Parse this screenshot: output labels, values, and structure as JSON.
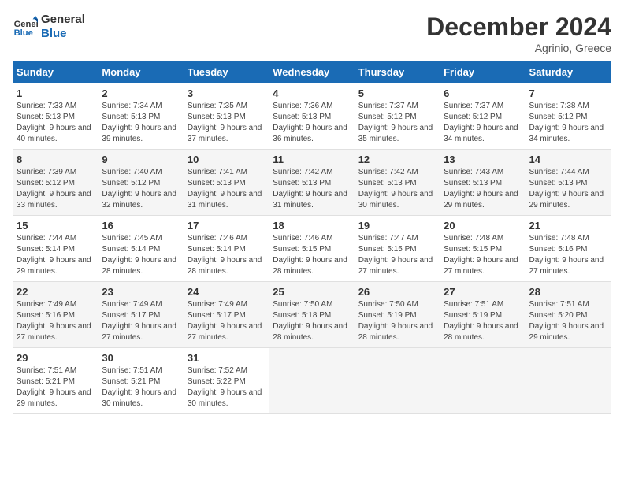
{
  "header": {
    "logo_general": "General",
    "logo_blue": "Blue",
    "month_title": "December 2024",
    "subtitle": "Agrinio, Greece"
  },
  "days_of_week": [
    "Sunday",
    "Monday",
    "Tuesday",
    "Wednesday",
    "Thursday",
    "Friday",
    "Saturday"
  ],
  "weeks": [
    [
      {
        "day": "1",
        "sunrise": "Sunrise: 7:33 AM",
        "sunset": "Sunset: 5:13 PM",
        "daylight": "Daylight: 9 hours and 40 minutes."
      },
      {
        "day": "2",
        "sunrise": "Sunrise: 7:34 AM",
        "sunset": "Sunset: 5:13 PM",
        "daylight": "Daylight: 9 hours and 39 minutes."
      },
      {
        "day": "3",
        "sunrise": "Sunrise: 7:35 AM",
        "sunset": "Sunset: 5:13 PM",
        "daylight": "Daylight: 9 hours and 37 minutes."
      },
      {
        "day": "4",
        "sunrise": "Sunrise: 7:36 AM",
        "sunset": "Sunset: 5:13 PM",
        "daylight": "Daylight: 9 hours and 36 minutes."
      },
      {
        "day": "5",
        "sunrise": "Sunrise: 7:37 AM",
        "sunset": "Sunset: 5:12 PM",
        "daylight": "Daylight: 9 hours and 35 minutes."
      },
      {
        "day": "6",
        "sunrise": "Sunrise: 7:37 AM",
        "sunset": "Sunset: 5:12 PM",
        "daylight": "Daylight: 9 hours and 34 minutes."
      },
      {
        "day": "7",
        "sunrise": "Sunrise: 7:38 AM",
        "sunset": "Sunset: 5:12 PM",
        "daylight": "Daylight: 9 hours and 34 minutes."
      }
    ],
    [
      {
        "day": "8",
        "sunrise": "Sunrise: 7:39 AM",
        "sunset": "Sunset: 5:12 PM",
        "daylight": "Daylight: 9 hours and 33 minutes."
      },
      {
        "day": "9",
        "sunrise": "Sunrise: 7:40 AM",
        "sunset": "Sunset: 5:12 PM",
        "daylight": "Daylight: 9 hours and 32 minutes."
      },
      {
        "day": "10",
        "sunrise": "Sunrise: 7:41 AM",
        "sunset": "Sunset: 5:13 PM",
        "daylight": "Daylight: 9 hours and 31 minutes."
      },
      {
        "day": "11",
        "sunrise": "Sunrise: 7:42 AM",
        "sunset": "Sunset: 5:13 PM",
        "daylight": "Daylight: 9 hours and 31 minutes."
      },
      {
        "day": "12",
        "sunrise": "Sunrise: 7:42 AM",
        "sunset": "Sunset: 5:13 PM",
        "daylight": "Daylight: 9 hours and 30 minutes."
      },
      {
        "day": "13",
        "sunrise": "Sunrise: 7:43 AM",
        "sunset": "Sunset: 5:13 PM",
        "daylight": "Daylight: 9 hours and 29 minutes."
      },
      {
        "day": "14",
        "sunrise": "Sunrise: 7:44 AM",
        "sunset": "Sunset: 5:13 PM",
        "daylight": "Daylight: 9 hours and 29 minutes."
      }
    ],
    [
      {
        "day": "15",
        "sunrise": "Sunrise: 7:44 AM",
        "sunset": "Sunset: 5:14 PM",
        "daylight": "Daylight: 9 hours and 29 minutes."
      },
      {
        "day": "16",
        "sunrise": "Sunrise: 7:45 AM",
        "sunset": "Sunset: 5:14 PM",
        "daylight": "Daylight: 9 hours and 28 minutes."
      },
      {
        "day": "17",
        "sunrise": "Sunrise: 7:46 AM",
        "sunset": "Sunset: 5:14 PM",
        "daylight": "Daylight: 9 hours and 28 minutes."
      },
      {
        "day": "18",
        "sunrise": "Sunrise: 7:46 AM",
        "sunset": "Sunset: 5:15 PM",
        "daylight": "Daylight: 9 hours and 28 minutes."
      },
      {
        "day": "19",
        "sunrise": "Sunrise: 7:47 AM",
        "sunset": "Sunset: 5:15 PM",
        "daylight": "Daylight: 9 hours and 27 minutes."
      },
      {
        "day": "20",
        "sunrise": "Sunrise: 7:48 AM",
        "sunset": "Sunset: 5:15 PM",
        "daylight": "Daylight: 9 hours and 27 minutes."
      },
      {
        "day": "21",
        "sunrise": "Sunrise: 7:48 AM",
        "sunset": "Sunset: 5:16 PM",
        "daylight": "Daylight: 9 hours and 27 minutes."
      }
    ],
    [
      {
        "day": "22",
        "sunrise": "Sunrise: 7:49 AM",
        "sunset": "Sunset: 5:16 PM",
        "daylight": "Daylight: 9 hours and 27 minutes."
      },
      {
        "day": "23",
        "sunrise": "Sunrise: 7:49 AM",
        "sunset": "Sunset: 5:17 PM",
        "daylight": "Daylight: 9 hours and 27 minutes."
      },
      {
        "day": "24",
        "sunrise": "Sunrise: 7:49 AM",
        "sunset": "Sunset: 5:17 PM",
        "daylight": "Daylight: 9 hours and 27 minutes."
      },
      {
        "day": "25",
        "sunrise": "Sunrise: 7:50 AM",
        "sunset": "Sunset: 5:18 PM",
        "daylight": "Daylight: 9 hours and 28 minutes."
      },
      {
        "day": "26",
        "sunrise": "Sunrise: 7:50 AM",
        "sunset": "Sunset: 5:19 PM",
        "daylight": "Daylight: 9 hours and 28 minutes."
      },
      {
        "day": "27",
        "sunrise": "Sunrise: 7:51 AM",
        "sunset": "Sunset: 5:19 PM",
        "daylight": "Daylight: 9 hours and 28 minutes."
      },
      {
        "day": "28",
        "sunrise": "Sunrise: 7:51 AM",
        "sunset": "Sunset: 5:20 PM",
        "daylight": "Daylight: 9 hours and 29 minutes."
      }
    ],
    [
      {
        "day": "29",
        "sunrise": "Sunrise: 7:51 AM",
        "sunset": "Sunset: 5:21 PM",
        "daylight": "Daylight: 9 hours and 29 minutes."
      },
      {
        "day": "30",
        "sunrise": "Sunrise: 7:51 AM",
        "sunset": "Sunset: 5:21 PM",
        "daylight": "Daylight: 9 hours and 30 minutes."
      },
      {
        "day": "31",
        "sunrise": "Sunrise: 7:52 AM",
        "sunset": "Sunset: 5:22 PM",
        "daylight": "Daylight: 9 hours and 30 minutes."
      },
      null,
      null,
      null,
      null
    ]
  ]
}
